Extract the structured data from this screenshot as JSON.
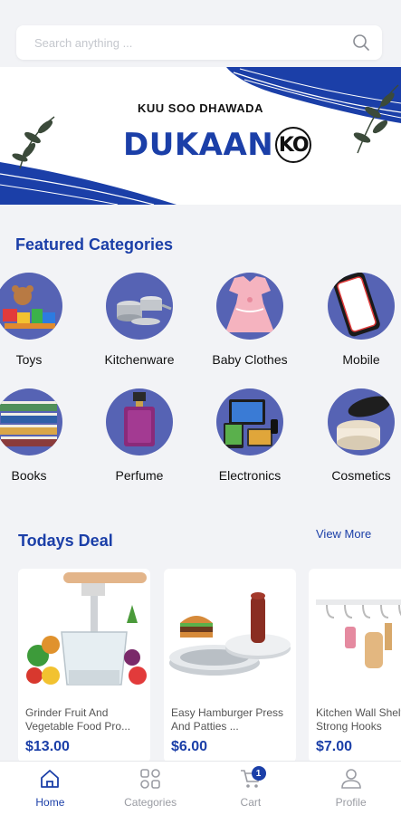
{
  "search": {
    "placeholder": "Search anything ..."
  },
  "banner": {
    "tagline": "KUU SOO DHAWADA",
    "logo_text": "DUKAAN",
    "logo_circle_text": "KO"
  },
  "featured": {
    "title": "Featured Categories",
    "items": [
      {
        "label": "Toys",
        "icon": "toys-image"
      },
      {
        "label": "Kitchenware",
        "icon": "cookware-image"
      },
      {
        "label": "Baby Clothes",
        "icon": "baby-dress-image"
      },
      {
        "label": "Mobile",
        "icon": "smartphone-image"
      },
      {
        "label": "Books",
        "icon": "books-image"
      },
      {
        "label": "Perfume",
        "icon": "perfume-image"
      },
      {
        "label": "Electronics",
        "icon": "electronics-image"
      },
      {
        "label": "Cosmetics",
        "icon": "cosmetics-image"
      }
    ]
  },
  "deals": {
    "title": "Todays Deal",
    "view_more": "View More",
    "items": [
      {
        "title": "Grinder Fruit And Vegetable Food Pro...",
        "price": "$13.00"
      },
      {
        "title": "Easy Hamburger Press And Patties ...",
        "price": "$6.00"
      },
      {
        "title": "Kitchen Wall Shelf With Strong Hooks",
        "price": "$7.00"
      }
    ]
  },
  "nav": {
    "items": [
      {
        "label": "Home",
        "icon": "home-icon",
        "active": true
      },
      {
        "label": "Categories",
        "icon": "categories-icon"
      },
      {
        "label": "Cart",
        "icon": "cart-icon",
        "badge": "1"
      },
      {
        "label": "Profile",
        "icon": "profile-icon"
      }
    ]
  },
  "colors": {
    "accent": "#1b3fa8",
    "category_circle": "#5663b4",
    "background": "#f2f3f6"
  }
}
